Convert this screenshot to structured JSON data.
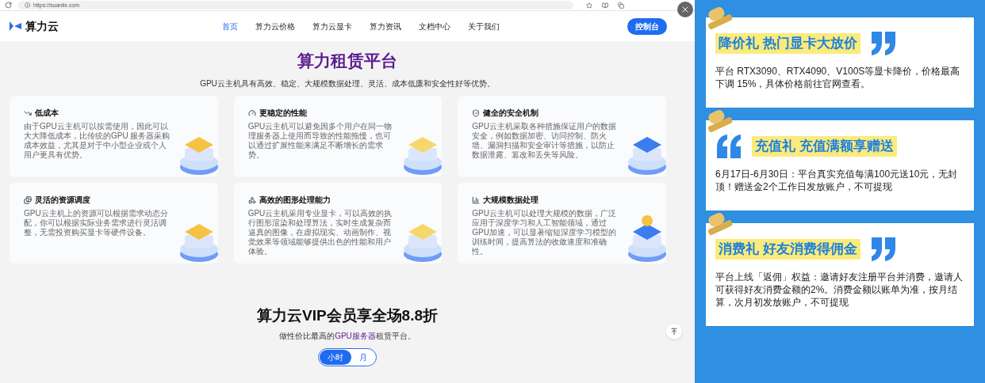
{
  "browser": {
    "url": "https://suanlix.com"
  },
  "nav": {
    "logo": "算力云",
    "items": [
      {
        "label": "首页",
        "selected": true
      },
      {
        "label": "算力云价格",
        "selected": false
      },
      {
        "label": "算力云显卡",
        "selected": false
      },
      {
        "label": "算力资讯",
        "selected": false
      },
      {
        "label": "文档中心",
        "selected": false
      },
      {
        "label": "关于我们",
        "selected": false
      }
    ],
    "console_button": "控制台"
  },
  "hero": {
    "title": "算力租赁平台",
    "subtitle": "GPU云主机具有高效、稳定、大规模数据处理、灵活、成本低廉和安全性好等优势。"
  },
  "features": [
    {
      "title": "低成本",
      "body": "由于GPU云主机可以按需使用，因此可以大大降低成本，比传统的GPU 服务器采购成本效益，尤其是对于中小型企业或个人用户更具有优势。"
    },
    {
      "title": "更稳定的性能",
      "body": "GPU云主机可以避免因多个用户在同一物理服务器上使用而导致的性能拖慢，也可以通过扩展性能来满足不断增长的需求势。"
    },
    {
      "title": "健全的安全机制",
      "body": "GPU云主机采取各种措施保证用户的数据安全，例如数据加密、访问控制、防火墙、漏洞扫描和安全审计等措施，以防止数据泄露、篡改和丢失等风险。"
    },
    {
      "title": "灵活的资源调度",
      "body": "GPU云主机上的资源可以根据需求动态分配，你可以根据实际业务需求进行灵活调整，无需投资购买显卡等硬件设备。"
    },
    {
      "title": "高效的图形处理能力",
      "body": "GPU云主机采用专业显卡，可以高效的执行图形渲染和处理算法，实时生成复杂而逼真的图像，在虚拟现实、动画制作、视觉效果等领域能够提供出色的性能和用户体验。"
    },
    {
      "title": "大规模数据处理",
      "body": "GPU云主机可以处理大规模的数据，广泛应用于深度学习和人工智能领域，通过GPU加速，可以显著缩短深度学习模型的训练时间，提高算法的收敛速度和准确性。"
    }
  ],
  "vip": {
    "title": "算力云VIP会员享全场8.8折",
    "subtitle_start": "做性价比最高的",
    "subtitle_highlight": "GPU服务器",
    "subtitle_end": "租赁平台。",
    "billing": [
      {
        "label": "小时",
        "selected": true
      },
      {
        "label": "月",
        "selected": false
      }
    ]
  },
  "poster": {
    "notes": [
      {
        "kind": "close_quote",
        "title": "降价礼  热门显卡大放价",
        "body": "平台 RTX3090、RTX4090、V100S等显卡降价，价格最高下调 15%，具体价格前往官网查看。"
      },
      {
        "kind": "open_quote",
        "title": "充值礼 充值满额享赠送",
        "body": "6月17日-6月30日：平台真实充值每满100元送10元，无封顶！赠送金2个工作日发放账户，不可提现"
      },
      {
        "kind": "close_quote",
        "title": "消费礼 好友消费得佣金",
        "body": "平台上线「返佣」权益：邀请好友注册平台并消费，邀请人可获得好友消费金额的2%。消费金额以账单为准，按月结算，次月初发放账户，不可提现"
      }
    ]
  }
}
